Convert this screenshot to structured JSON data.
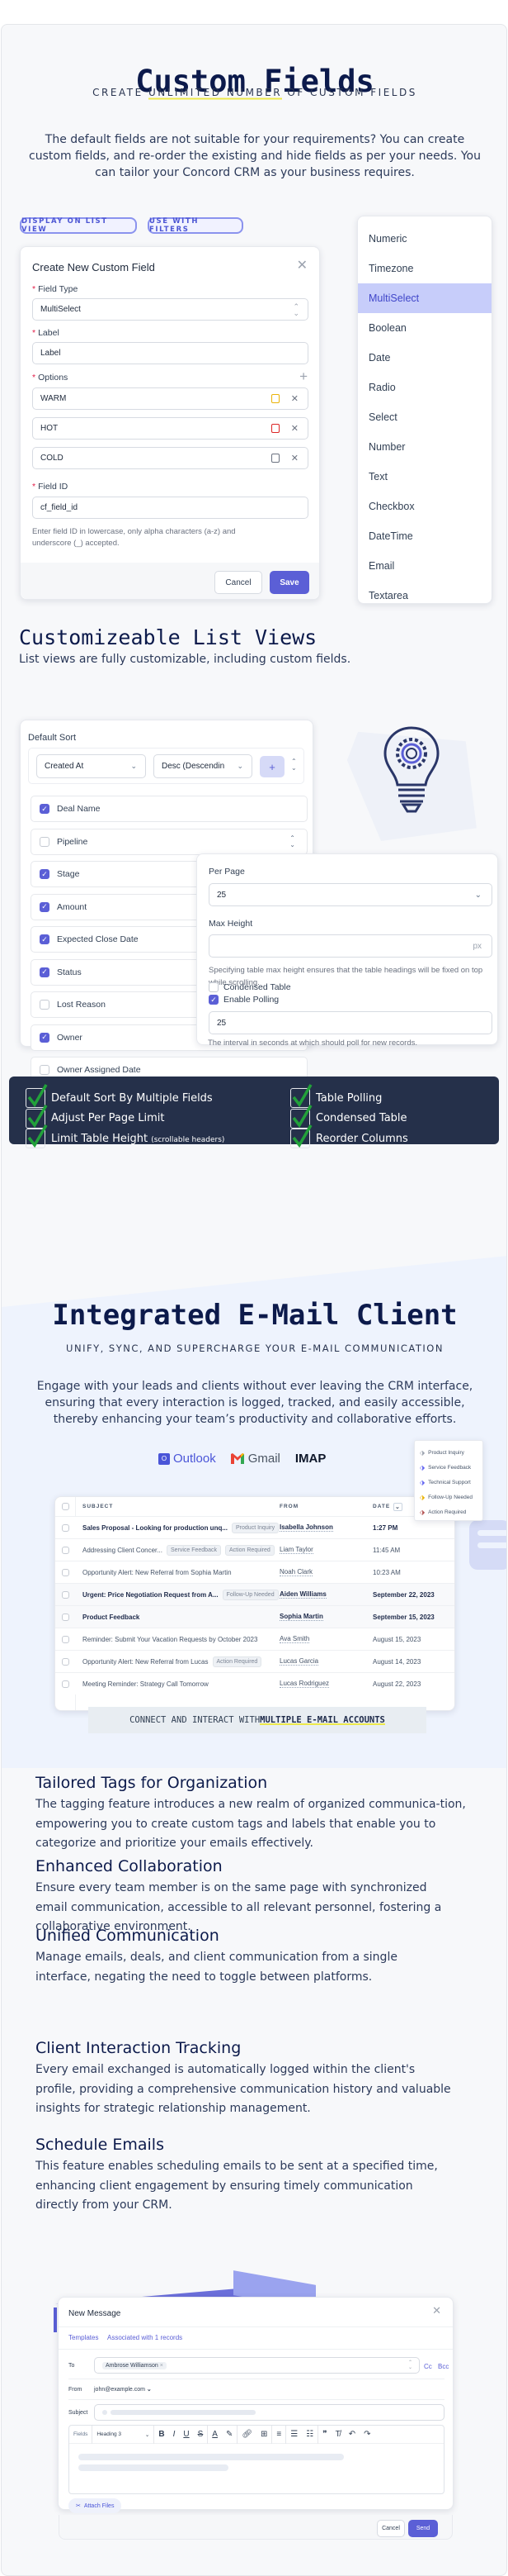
{
  "custom_fields": {
    "title": "Custom Fields",
    "subtitle_prefix": "CREATE ",
    "subtitle_highlight": "UNLIMITED NUMBER",
    "subtitle_suffix": " OF CUSTOM FIELDS",
    "description": "The default fields are not suitable for your requirements? You can create custom fields, and re-order the existing and hide fields as per your needs. You can tailor your Concord CRM as your business requires.",
    "pills": [
      "DISPLAY ON LIST VIEW",
      "USE WITH FILTERS"
    ],
    "modal": {
      "title": "Create New Custom Field",
      "field_type_label": "Field Type",
      "field_type_value": "MultiSelect",
      "label_label": "Label",
      "label_value": "Label",
      "options_label": "Options",
      "options": [
        {
          "value": "WARM",
          "color": "#eab308"
        },
        {
          "value": "HOT",
          "color": "#dc2626"
        },
        {
          "value": "COLD",
          "color": "#6b7280"
        }
      ],
      "field_id_label": "Field ID",
      "field_id_value": "cf_field_id",
      "field_id_help": "Enter field ID in lowercase, only alpha characters (a-z) and underscore (_) accepted.",
      "cancel": "Cancel",
      "save": "Save"
    },
    "type_dropdown": {
      "items": [
        "Numeric",
        "Timezone",
        "MultiSelect",
        "Boolean",
        "Date",
        "Radio",
        "Select",
        "Number",
        "Text",
        "Checkbox",
        "DateTime",
        "Email",
        "Textarea"
      ],
      "selected": "MultiSelect"
    }
  },
  "list_views": {
    "title": "Customizeable List Views",
    "subtitle": "List views are fully customizable, including custom fields.",
    "default_sort_label": "Default Sort",
    "sort_field": "Created At",
    "sort_dir": "Desc (Descendin",
    "add_label": "+",
    "columns": [
      {
        "label": "Deal Name",
        "checked": true
      },
      {
        "label": "Pipeline",
        "checked": false
      },
      {
        "label": "Stage",
        "checked": true
      },
      {
        "label": "Amount",
        "checked": true
      },
      {
        "label": "Expected Close Date",
        "checked": true
      },
      {
        "label": "Status",
        "checked": true
      },
      {
        "label": "Lost Reason",
        "checked": false
      },
      {
        "label": "Owner",
        "checked": true
      },
      {
        "label": "Owner Assigned Date",
        "checked": false
      }
    ],
    "settings": {
      "per_page_label": "Per Page",
      "per_page_value": "25",
      "max_height_label": "Max Height",
      "max_height_suffix": "px",
      "max_height_help": "Specifying table max height ensures that the table headings will be fixed on top while scrolling.",
      "condensed_label": "Condensed Table",
      "condensed_checked": false,
      "polling_label": "Enable Polling",
      "polling_checked": true,
      "polling_value": "25",
      "polling_help": "The interval in seconds at which should poll for new records."
    },
    "features": [
      {
        "label": "Default Sort By Multiple Fields",
        "note": ""
      },
      {
        "label": "Table Polling",
        "note": ""
      },
      {
        "label": "Adjust Per Page Limit",
        "note": ""
      },
      {
        "label": "Condensed Table",
        "note": ""
      },
      {
        "label": "Limit Table Height",
        "note": "(scrollable headers)"
      },
      {
        "label": "Reorder Columns",
        "note": ""
      }
    ]
  },
  "email": {
    "title": "Integrated E-Mail Client",
    "subtitle": "UNIFY, SYNC, AND SUPERCHARGE YOUR E-MAIL COMMUNICATION",
    "description": "Engage with your leads and clients without ever leaving the CRM interface, ensuring that every interaction is logged, tracked, and easily accessible, thereby enhancing your team’s productivity and collaborative efforts.",
    "providers": [
      "Outlook",
      "Gmail",
      "IMAP"
    ],
    "tags_menu": [
      {
        "label": "Product Inquiry",
        "color": "#9ca3af"
      },
      {
        "label": "Service Feedback",
        "color": "#6366f1"
      },
      {
        "label": "Technical Support",
        "color": "#6366f1"
      },
      {
        "label": "Follow-Up Needed",
        "color": "#eab308"
      },
      {
        "label": "Action Required",
        "color": "#b45353"
      }
    ],
    "table": {
      "headers": {
        "subject": "SUBJECT",
        "from": "FROM",
        "date": "DATE"
      },
      "rows": [
        {
          "subject": "Sales Proposal - Looking for production unq...",
          "tags": [
            "Product Inquiry"
          ],
          "from": "Isabella Johnson",
          "date": "1:27 PM",
          "unread": true
        },
        {
          "subject": "Addressing Client Concer...",
          "tags": [
            "Service Feedback",
            "Action Required"
          ],
          "from": "Liam Taylor",
          "date": "11:45 AM",
          "unread": false
        },
        {
          "subject": "Opportunity Alert: New Referral from Sophia Martin",
          "tags": [],
          "from": "Noah Clark",
          "date": "10:23 AM",
          "unread": false
        },
        {
          "subject": "Urgent: Price Negotiation Request from A...",
          "tags": [
            "Follow-Up Needed"
          ],
          "from": "Aiden Williams",
          "date": "September 22, 2023",
          "unread": true
        },
        {
          "subject": "Product Feedback",
          "tags": [],
          "from": "Sophia Martin",
          "date": "September 15, 2023",
          "unread": true
        },
        {
          "subject": "Reminder: Submit Your Vacation Requests by October 2023",
          "tags": [],
          "from": "Ava Smith",
          "date": "August 15, 2023",
          "unread": false
        },
        {
          "subject": "Opportunity Alert: New Referral from Lucas",
          "tags": [
            "Action Required"
          ],
          "from": "Lucas Garcia",
          "date": "August 14, 2023",
          "unread": false
        },
        {
          "subject": "Meeting Reminder: Strategy Call Tomorrow",
          "tags": [],
          "from": "Lucas Rodriguez",
          "date": "August 22, 2023",
          "unread": false
        }
      ]
    },
    "connect_prefix": "CONNECT AND INTERACT WITH ",
    "connect_highlight": "MULTIPLE E-MAIL ACCOUNTS",
    "sections": [
      {
        "title": "Tailored Tags for Organization",
        "body": "The tagging feature introduces a new realm of organized communica-tion, empowering you to create custom tags and labels that enable you to categorize and prioritize your emails effectively."
      },
      {
        "title": "Enhanced Collaboration",
        "body": "Ensure every team member is on the same page with synchronized email communication, accessible to all relevant personnel, fostering a collaborative environment."
      },
      {
        "title": "Unified Communication",
        "body": "Manage emails, deals, and client communication from a single interface, negating the need to toggle between platforms."
      },
      {
        "title": "Client Interaction Tracking",
        "body": "Every email exchanged is automatically logged within the client's profile, providing a comprehensive communication history and valuable insights for strategic relationship management."
      },
      {
        "title": "Schedule Emails",
        "body": "This feature enables scheduling emails to be sent at a specified time, enhancing client engagement by ensuring timely communication directly from your CRM."
      }
    ],
    "compose": {
      "title": "New Message",
      "templates": "Templates",
      "associated": "Associated with 1 records",
      "to_label": "To",
      "to_recipient": "Ambrose Williamson",
      "cc": "Cc",
      "bcc": "Bcc",
      "from_label": "From",
      "from_value": "john@example.com",
      "subject_label": "Subject",
      "fields_label": "Fields",
      "heading_value": "Heading 3",
      "attach": "Attach Files",
      "cancel": "Cancel",
      "send": "Send"
    }
  },
  "colors": {
    "accent": "#5b5fd6",
    "navy": "#0c1a4b",
    "dark_panel": "#25304a",
    "check_green": "#22a13a",
    "highlight_yellow": "#ede84a"
  }
}
